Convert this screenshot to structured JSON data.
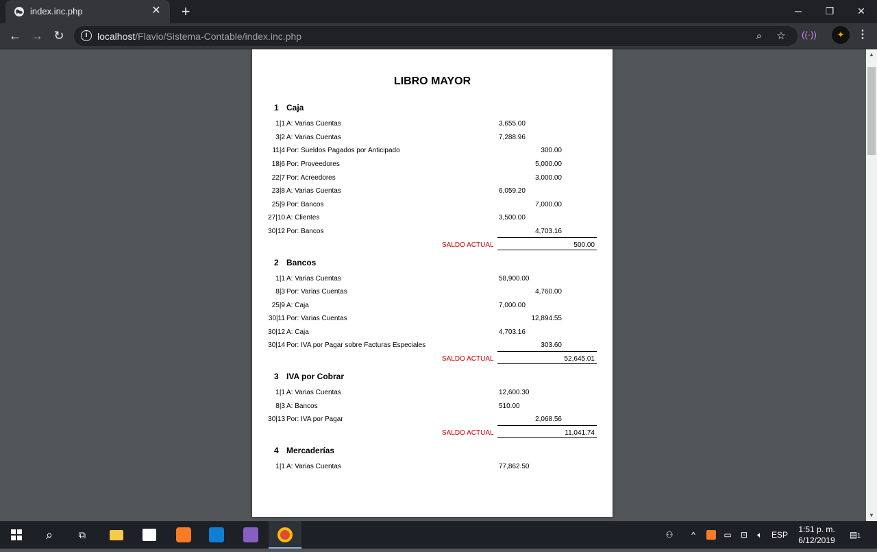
{
  "browser": {
    "tab_title": "index.inc.php",
    "url_host": "localhost",
    "url_path": "/Flavio/Sistema-Contable/index.inc.php"
  },
  "document": {
    "title": "LIBRO MAYOR",
    "saldo_label": "SALDO ACTUAL",
    "accounts": [
      {
        "number": "1",
        "name": "Caja",
        "entries": [
          {
            "ref": "1|1",
            "desc": "A: Varias Cuentas",
            "debit": "3,655.00",
            "credit": ""
          },
          {
            "ref": "3|2",
            "desc": "A: Varias Cuentas",
            "debit": "7,288.96",
            "credit": ""
          },
          {
            "ref": "11|4",
            "desc": "Por: Sueldos Pagados por Anticipado",
            "debit": "",
            "credit": "300.00"
          },
          {
            "ref": "18|6",
            "desc": "Por: Proveedores",
            "debit": "",
            "credit": "5,000.00"
          },
          {
            "ref": "22|7",
            "desc": "Por: Acreedores",
            "debit": "",
            "credit": "3,000.00"
          },
          {
            "ref": "23|8",
            "desc": "A: Varias Cuentas",
            "debit": "6,059.20",
            "credit": ""
          },
          {
            "ref": "25|9",
            "desc": "Por: Bancos",
            "debit": "",
            "credit": "7,000.00"
          },
          {
            "ref": "27|10",
            "desc": "A: Clientes",
            "debit": "3,500.00",
            "credit": ""
          },
          {
            "ref": "30|12",
            "desc": "Por: Bancos",
            "debit": "",
            "credit": "4,703.16"
          }
        ],
        "saldo": "500.00"
      },
      {
        "number": "2",
        "name": "Bancos",
        "entries": [
          {
            "ref": "1|1",
            "desc": "A: Varias Cuentas",
            "debit": "58,900.00",
            "credit": ""
          },
          {
            "ref": "8|3",
            "desc": "Por: Varias Cuentas",
            "debit": "",
            "credit": "4,760.00"
          },
          {
            "ref": "25|9",
            "desc": "A: Caja",
            "debit": "7,000.00",
            "credit": ""
          },
          {
            "ref": "30|11",
            "desc": "Por: Varias Cuentas",
            "debit": "",
            "credit": "12,894.55"
          },
          {
            "ref": "30|12",
            "desc": "A: Caja",
            "debit": "4,703.16",
            "credit": ""
          },
          {
            "ref": "30|14",
            "desc": "Por: IVA por Pagar sobre Facturas Especiales",
            "debit": "",
            "credit": "303.60"
          }
        ],
        "saldo": "52,645.01"
      },
      {
        "number": "3",
        "name": "IVA por Cobrar",
        "entries": [
          {
            "ref": "1|1",
            "desc": "A: Varias Cuentas",
            "debit": "12,600.30",
            "credit": ""
          },
          {
            "ref": "8|3",
            "desc": "A: Bancos",
            "debit": "510.00",
            "credit": ""
          },
          {
            "ref": "30|13",
            "desc": "Por: IVA por Pagar",
            "debit": "",
            "credit": "2,068.56"
          }
        ],
        "saldo": "11,041.74"
      },
      {
        "number": "4",
        "name": "Mercaderías",
        "entries": [
          {
            "ref": "1|1",
            "desc": "A: Varias Cuentas",
            "debit": "77,862.50",
            "credit": ""
          }
        ],
        "saldo": null
      }
    ]
  },
  "taskbar": {
    "language": "ESP",
    "time": "1:51 p. m.",
    "date": "6/12/2019",
    "notification_count": "1"
  },
  "icons": {
    "tab_favicon": "globe-icon",
    "new_tab": "plus-icon",
    "back": "arrow-left-icon",
    "forward": "arrow-right-icon",
    "reload": "reload-icon",
    "site_info": "info-icon",
    "zoom": "magnifier-icon",
    "bookmark": "star-icon",
    "menu": "kebab-menu-icon"
  }
}
